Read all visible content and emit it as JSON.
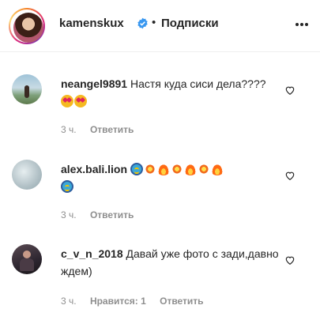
{
  "header": {
    "username": "kamenskux",
    "separator": "•",
    "follow_label": "Подписки",
    "verified_icon": "verified-badge-icon",
    "more_icon": "more-options-icon"
  },
  "comments": [
    {
      "username": "neangel9891",
      "text": "Настя куда сиси дела????",
      "emojis": [
        "heart-eyes-emoji",
        "heart-eyes-emoji"
      ],
      "time": "3 ч.",
      "likes_label": "",
      "reply_label": "Ответить"
    },
    {
      "username": "alex.bali.lion",
      "text": "",
      "emojis": [
        "cyclone-emoji",
        "collision-emoji",
        "fire-emoji",
        "collision-emoji",
        "fire-emoji",
        "collision-emoji",
        "fire-emoji",
        "cyclone-emoji"
      ],
      "time": "3 ч.",
      "likes_label": "",
      "reply_label": "Ответить"
    },
    {
      "username": "c_v_n_2018",
      "text": "Давай уже фото с зади,давно ждем)",
      "emojis": [],
      "time": "3 ч.",
      "likes_label": "Нравится: 1",
      "reply_label": "Ответить"
    }
  ],
  "colors": {
    "text": "#262626",
    "secondary": "#8e8e8e",
    "verified": "#3897f0",
    "divider": "#efefef"
  }
}
